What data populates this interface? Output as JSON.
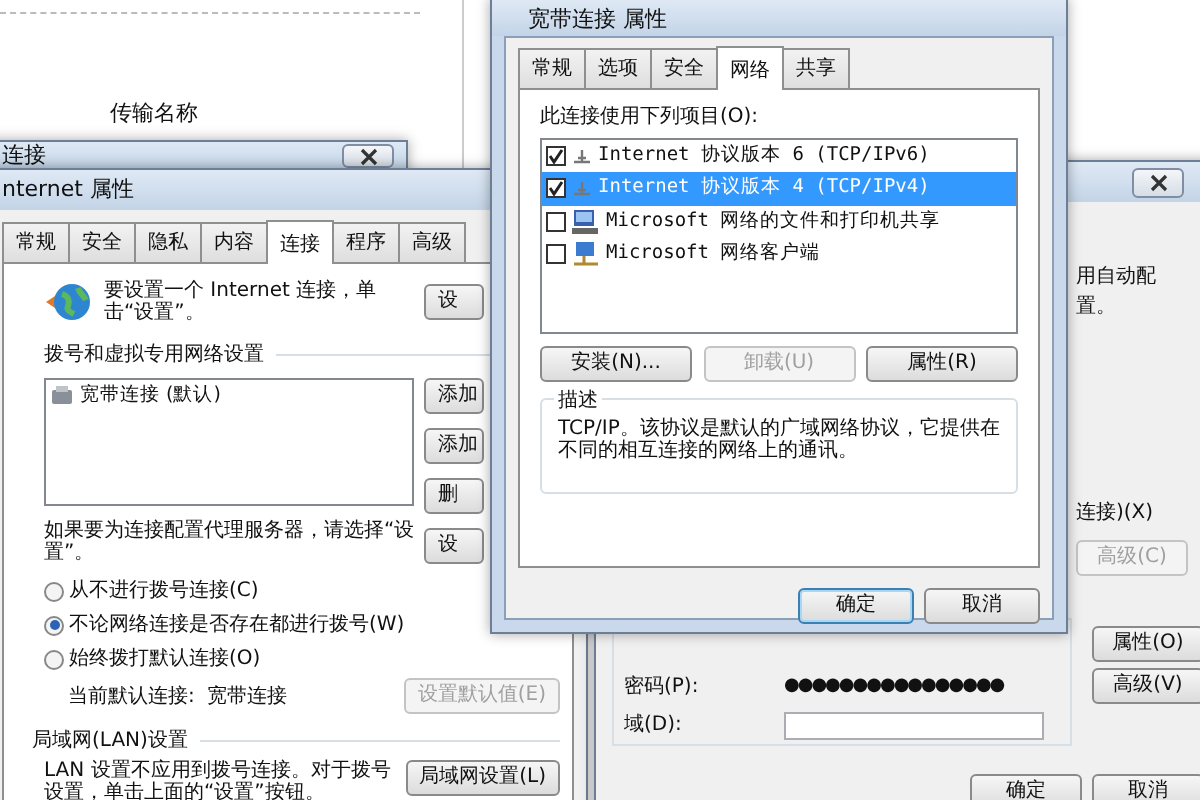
{
  "background_page": {
    "heading": "传输名称"
  },
  "connections_window": {
    "title": "连接"
  },
  "internet_properties": {
    "title": "nternet 属性",
    "tabs": [
      {
        "label": "常规",
        "selected": false
      },
      {
        "label": "安全",
        "selected": false
      },
      {
        "label": "隐私",
        "selected": false
      },
      {
        "label": "内容",
        "selected": false
      },
      {
        "label": "连接",
        "selected": true
      },
      {
        "label": "程序",
        "selected": false
      },
      {
        "label": "高级",
        "selected": false
      }
    ],
    "setup_text": "要设置一个 Internet 连接，单击“设置”。",
    "setup_button": "设",
    "dialup_heading": "拨号和虚拟专用网络设置",
    "connections": [
      {
        "label": "宽带连接 (默认)",
        "selected": false
      }
    ],
    "side_buttons": [
      "添加",
      "添加",
      "删",
      "设"
    ],
    "proxy_text": "如果要为连接配置代理服务器，请选择“设置”。",
    "dial_options": [
      {
        "label": "从不进行拨号连接(C)",
        "selected": false
      },
      {
        "label": "不论网络连接是否存在都进行拨号(W)",
        "selected": true
      },
      {
        "label": "始终拨打默认连接(O)",
        "selected": false
      }
    ],
    "default_label": "当前默认连接:",
    "default_value": "宽带连接",
    "set_default_button": {
      "label": "设置默认值(E)",
      "disabled": true
    },
    "lan_heading": "局域网(LAN)设置",
    "lan_text": "LAN 设置不应用到拨号连接。对于拨号设置，单击上面的“设置”按钮。",
    "lan_button": "局域网设置(L)"
  },
  "network_settings": {
    "auto_config_text": "用自动配置。",
    "option_text": "连接)(X)",
    "upper_button": {
      "label": "高级(C)",
      "disabled": true
    },
    "properties_button": "属性(O)",
    "password_label": "密码(P):",
    "password": "●●●●●●●●●●●●●●●●",
    "advanced_button": "高级(V)",
    "domain_label": "域(D):",
    "footer_buttons": [
      "确定",
      "取消"
    ]
  },
  "broadband_properties": {
    "title": "宽带连接 属性",
    "tabs": [
      {
        "label": "常规",
        "selected": false
      },
      {
        "label": "选项",
        "selected": false
      },
      {
        "label": "安全",
        "selected": false
      },
      {
        "label": "网络",
        "selected": true
      },
      {
        "label": "共享",
        "selected": false
      }
    ],
    "items_label": "此连接使用下列项目(O):",
    "items": [
      {
        "kind": "protocol",
        "label": "Internet 协议版本 6 (TCP/IPv6)",
        "checked": true,
        "selected": false
      },
      {
        "kind": "protocol",
        "label": "Internet 协议版本 4 (TCP/IPv4)",
        "checked": true,
        "selected": true
      },
      {
        "kind": "service",
        "label": "Microsoft 网络的文件和打印机共享",
        "checked": false,
        "selected": false
      },
      {
        "kind": "client",
        "label": "Microsoft 网络客户端",
        "checked": false,
        "selected": false
      }
    ],
    "buttons": [
      {
        "label": "安装(N)...",
        "disabled": false
      },
      {
        "label": "卸载(U)",
        "disabled": true
      },
      {
        "label": "属性(R)",
        "disabled": false
      }
    ],
    "description_heading": "描述",
    "description": "TCP/IP。该协议是默认的广域网络协议，它提供在不同的相互连接的网络上的通讯。",
    "footer_buttons": [
      "确定",
      "取消"
    ]
  }
}
